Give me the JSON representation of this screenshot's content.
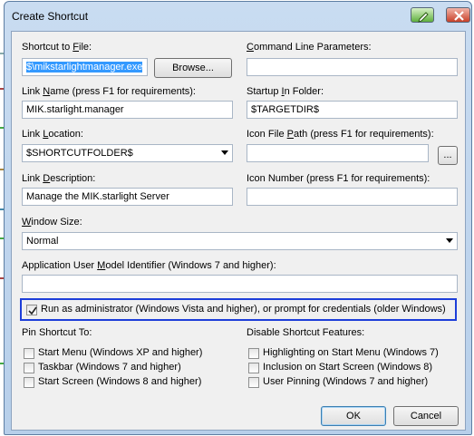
{
  "window": {
    "title": "Create Shortcut"
  },
  "fields": {
    "shortcut_to_file": {
      "label_pre": "Shortcut to ",
      "label_u": "F",
      "label_post": "ile:",
      "value": "$\\mikstarlightmanager.exe"
    },
    "browse_label": "Browse...",
    "command_line": {
      "label_pre": "",
      "label_u": "C",
      "label_post": "ommand Line Parameters:",
      "value": ""
    },
    "link_name": {
      "label_pre": "Link ",
      "label_u": "N",
      "label_post": "ame (press F1 for requirements):",
      "value": "MIK.starlight.manager"
    },
    "startup_folder": {
      "label_pre": "Startup ",
      "label_u": "I",
      "label_post": "n Folder:",
      "value": "$TARGETDIR$"
    },
    "link_location": {
      "label_pre": "Link ",
      "label_u": "L",
      "label_post": "ocation:",
      "value": "$SHORTCUTFOLDER$"
    },
    "icon_file_path": {
      "label_pre": "Icon File ",
      "label_u": "P",
      "label_post": "ath (press F1 for requirements):",
      "value": ""
    },
    "icon_browse_label": "...",
    "link_description": {
      "label_pre": "Link ",
      "label_u": "D",
      "label_post": "escription:",
      "value": "Manage the MIK.starlight Server"
    },
    "icon_number": {
      "label_pre": "Icon Number (press F1 for requirements):",
      "value": ""
    },
    "window_size": {
      "label_pre": "",
      "label_u": "W",
      "label_post": "indow Size:",
      "value": "Normal"
    },
    "app_user_model": {
      "label_pre": "Application User ",
      "label_u": "M",
      "label_post": "odel Identifier (Windows 7 and higher):",
      "value": ""
    }
  },
  "run_as_admin": {
    "label": "Run as administrator (Windows Vista and higher), or prompt for credentials (older Windows)",
    "checked": true
  },
  "pin_shortcut": {
    "title": "Pin Shortcut To:",
    "items": [
      {
        "label": "Start Menu (Windows XP and higher)",
        "checked": false
      },
      {
        "label": "Taskbar (Windows 7 and higher)",
        "checked": false
      },
      {
        "label": "Start Screen (Windows 8 and higher)",
        "checked": false
      }
    ]
  },
  "disable_features": {
    "title": "Disable Shortcut Features:",
    "items": [
      {
        "label": "Highlighting on Start Menu (Windows 7)",
        "checked": false
      },
      {
        "label": "Inclusion on Start Screen (Windows 8)",
        "checked": false
      },
      {
        "label": "User Pinning (Windows 7 and higher)",
        "checked": false
      }
    ]
  },
  "buttons": {
    "ok": "OK",
    "cancel": "Cancel"
  },
  "colors": {
    "highlight_border": "#1d3ed9",
    "selection": "#3399ff"
  }
}
